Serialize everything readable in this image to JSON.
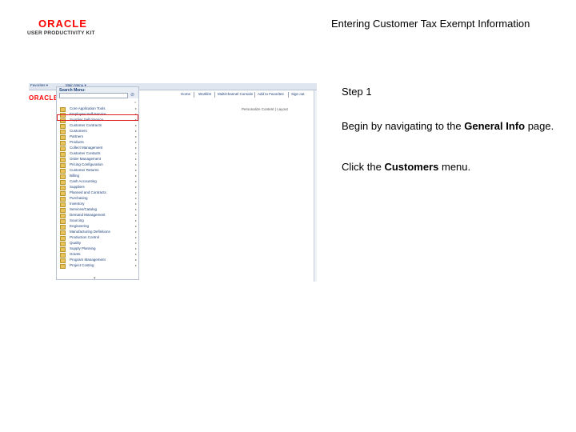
{
  "logo": {
    "brand": "ORACLE",
    "product": "USER PRODUCTIVITY KIT"
  },
  "doc_title": "Entering Customer Tax Exempt Information",
  "screenshot": {
    "topbar": {
      "favorites": "Favorites ▾",
      "main_menu": "Main Menu ▾"
    },
    "nav_links": [
      "Home",
      "Worklist",
      "MultiChannel Console",
      "Add to Favorites",
      "Sign out"
    ],
    "oracle_mark": "ORACLE",
    "personalize": "Personalize Content | Layout",
    "menu": {
      "title": "Search Menu:",
      "search_value": "",
      "collapse": "⌃",
      "items": [
        {
          "label": "Core Application Tools",
          "arrow": "▸"
        },
        {
          "label": "Employee Self-Service",
          "arrow": "▸"
        },
        {
          "label": "Supplier Self-Service",
          "arrow": "▸"
        },
        {
          "label": "Customer Contracts",
          "arrow": "▸"
        },
        {
          "label": "Customers",
          "arrow": "▸"
        },
        {
          "label": "Partners",
          "arrow": "▸"
        },
        {
          "label": "Products",
          "arrow": "▸"
        },
        {
          "label": "Collect Management",
          "arrow": "▸"
        },
        {
          "label": "Customer Contacts",
          "arrow": "▸"
        },
        {
          "label": "Order Management",
          "arrow": "▸"
        },
        {
          "label": "Pricing Configuration",
          "arrow": "▸"
        },
        {
          "label": "Customer Returns",
          "arrow": "▸"
        },
        {
          "label": "Billing",
          "arrow": "▸"
        },
        {
          "label": "Cash Accounting",
          "arrow": "▸"
        },
        {
          "label": "Suppliers",
          "arrow": "▸"
        },
        {
          "label": "Planned and Contracts",
          "arrow": "▸"
        },
        {
          "label": "Purchasing",
          "arrow": "▸"
        },
        {
          "label": "Inventory",
          "arrow": "▸"
        },
        {
          "label": "Services/Catalog",
          "arrow": "▸"
        },
        {
          "label": "Demand Management",
          "arrow": "▸"
        },
        {
          "label": "Sourcing",
          "arrow": "▸"
        },
        {
          "label": "Engineering",
          "arrow": "▸"
        },
        {
          "label": "Manufacturing Definitions",
          "arrow": "▸"
        },
        {
          "label": "Production Control",
          "arrow": "▸"
        },
        {
          "label": "Quality",
          "arrow": "▸"
        },
        {
          "label": "Supply Planning",
          "arrow": "▸"
        },
        {
          "label": "Grants",
          "arrow": "▸"
        },
        {
          "label": "Program Management",
          "arrow": "▸"
        },
        {
          "label": "Project Costing",
          "arrow": "▸"
        }
      ],
      "scroll_indicator": "▾"
    }
  },
  "step": "Step 1",
  "instruction1": {
    "pre": "Begin by navigating to the ",
    "bold": "General Info",
    "post": " page."
  },
  "instruction2": {
    "pre": "Click the ",
    "bold": "Customers",
    "post": " menu."
  },
  "colors": {
    "brand_red": "#ff0000",
    "link_blue": "#1a3f7a",
    "highlight_red": "#e02020"
  }
}
